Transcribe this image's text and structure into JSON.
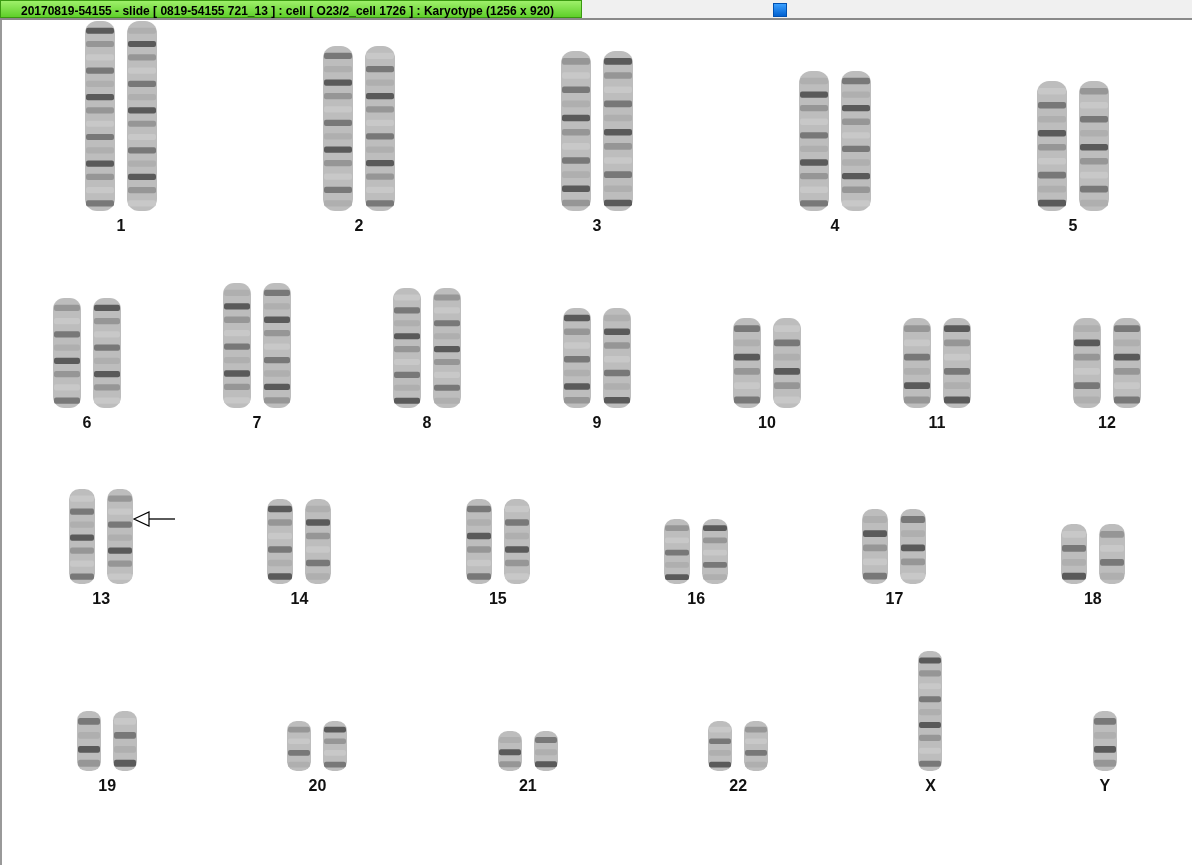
{
  "window": {
    "title": "20170819-54155 - slide [ 0819-54155 721_13 ] : cell [ O23/2_cell 1726 ] : Karyotype  (1256 x 920)"
  },
  "karyotype": {
    "rows": [
      {
        "groups": [
          {
            "label": "1",
            "kind": "pair",
            "marked": false
          },
          {
            "label": "2",
            "kind": "pair",
            "marked": false
          },
          {
            "label": "3",
            "kind": "pair",
            "marked": false
          },
          {
            "label": "4",
            "kind": "pair",
            "marked": false
          },
          {
            "label": "5",
            "kind": "pair",
            "marked": false
          }
        ]
      },
      {
        "groups": [
          {
            "label": "6",
            "kind": "pair",
            "marked": false
          },
          {
            "label": "7",
            "kind": "pair",
            "marked": false
          },
          {
            "label": "8",
            "kind": "pair",
            "marked": false
          },
          {
            "label": "9",
            "kind": "pair",
            "marked": false
          },
          {
            "label": "10",
            "kind": "pair",
            "marked": false
          },
          {
            "label": "11",
            "kind": "pair",
            "marked": false
          },
          {
            "label": "12",
            "kind": "pair",
            "marked": false
          }
        ]
      },
      {
        "groups": [
          {
            "label": "13",
            "kind": "pair",
            "marked": true
          },
          {
            "label": "14",
            "kind": "pair",
            "marked": false
          },
          {
            "label": "15",
            "kind": "pair",
            "marked": false
          },
          {
            "label": "16",
            "kind": "pair",
            "marked": false
          },
          {
            "label": "17",
            "kind": "pair",
            "marked": false
          },
          {
            "label": "18",
            "kind": "pair",
            "marked": false
          }
        ]
      },
      {
        "groups": [
          {
            "label": "19",
            "kind": "pair",
            "marked": false
          },
          {
            "label": "20",
            "kind": "pair",
            "marked": false
          },
          {
            "label": "21",
            "kind": "pair",
            "marked": false
          },
          {
            "label": "22",
            "kind": "pair",
            "marked": false
          },
          {
            "label": "X",
            "kind": "single",
            "marked": false
          },
          {
            "label": "Y",
            "kind": "single",
            "marked": false
          }
        ]
      }
    ]
  }
}
